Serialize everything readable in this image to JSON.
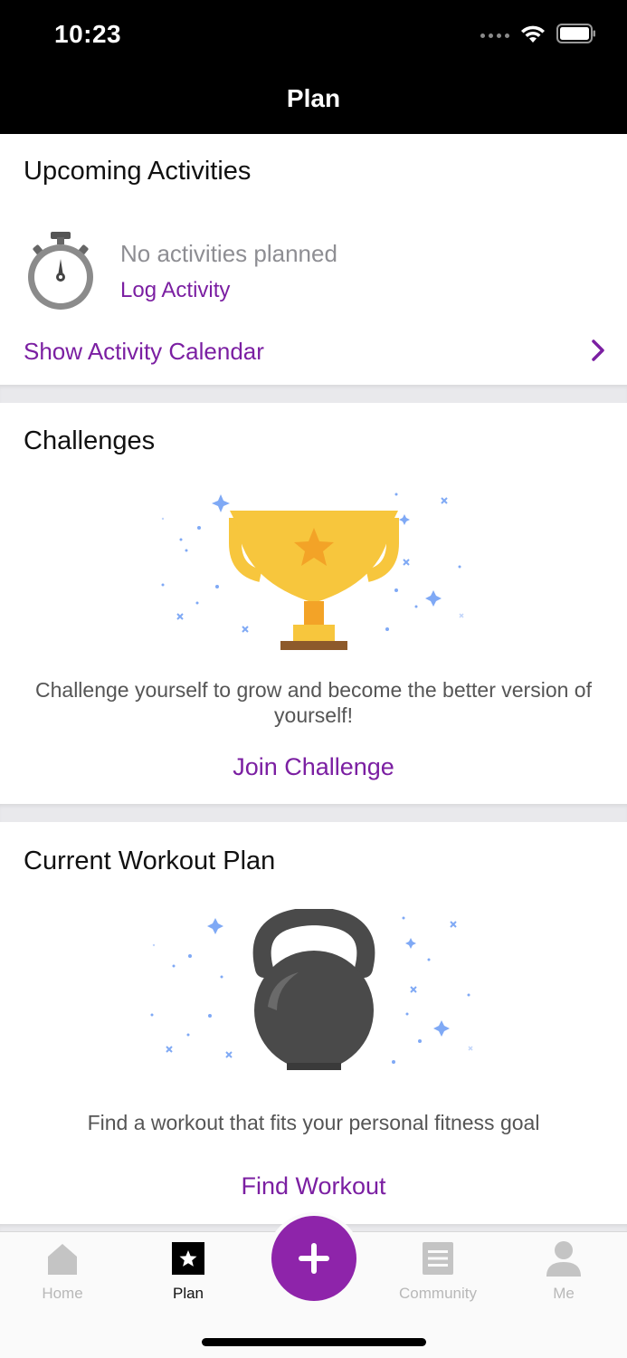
{
  "status_bar": {
    "time": "10:23"
  },
  "nav": {
    "title": "Plan"
  },
  "upcoming": {
    "title": "Upcoming Activities",
    "empty_text": "No activities planned",
    "log_link": "Log Activity",
    "calendar_link": "Show Activity Calendar"
  },
  "challenges": {
    "title": "Challenges",
    "description": "Challenge yourself to grow and become the better version of yourself!",
    "join_link": "Join Challenge"
  },
  "workout": {
    "title": "Current Workout Plan",
    "description": "Find a workout that fits your personal fitness goal",
    "find_link": "Find Workout"
  },
  "tabbar": {
    "tabs": [
      {
        "label": "Home",
        "icon": "home-icon",
        "active": false
      },
      {
        "label": "Plan",
        "icon": "plan-star-icon",
        "active": true
      },
      {
        "label": "Community",
        "icon": "community-list-icon",
        "active": false
      },
      {
        "label": "Me",
        "icon": "person-icon",
        "active": false
      }
    ],
    "fab_icon": "plus-icon"
  },
  "colors": {
    "accent": "#7b1fa2",
    "fab": "#8e24aa",
    "trophy": "#f7c63d",
    "trophy_star": "#f3a327",
    "kettlebell": "#4a4a4a",
    "sparkle": "#7fa9f5"
  }
}
